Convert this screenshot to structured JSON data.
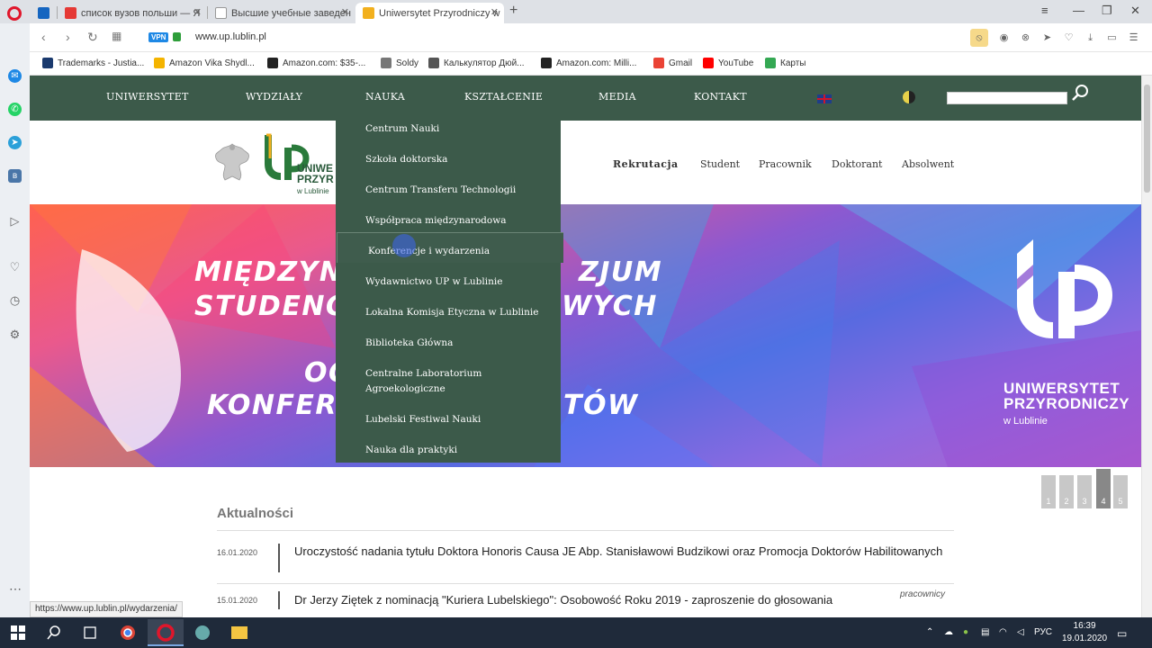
{
  "browser": {
    "tabs": [
      {
        "label": "",
        "icon_color": "#1565c0"
      },
      {
        "label": "список вузов польши — Я",
        "icon_color": "#e53935"
      },
      {
        "label": "Высшие учебные заведен",
        "icon_color": "#333333"
      },
      {
        "label": "Uniwersytet Przyrodniczy w",
        "icon_color": "#f2b01e"
      }
    ],
    "url": "www.up.lublin.pl",
    "vpn_label": "VPN",
    "bookmarks": [
      {
        "label": "Trademarks - Justia...",
        "color": "#1a3a6e"
      },
      {
        "label": "Amazon Vika Shydl...",
        "color": "#f4b400"
      },
      {
        "label": "Amazon.com: $35-...",
        "color": "#222222"
      },
      {
        "label": "Soldy",
        "color": "#777777"
      },
      {
        "label": "Калькулятор Дюй...",
        "color": "#555555"
      },
      {
        "label": "Amazon.com: Milli...",
        "color": "#222222"
      },
      {
        "label": "Gmail",
        "color": "#ea4335"
      },
      {
        "label": "YouTube",
        "color": "#ff0000"
      },
      {
        "label": "Карты",
        "color": "#34a853"
      }
    ]
  },
  "site": {
    "nav": [
      "UNIWERSYTET",
      "WYDZIAŁY",
      "NAUKA",
      "KSZTAŁCENIE",
      "MEDIA",
      "KONTAKT"
    ],
    "logo": {
      "line1": "UNIWE",
      "line2": "PRZYR",
      "line3": "w Lublinie"
    },
    "header_links": [
      "Rekrutacja",
      "Student",
      "Pracownik",
      "Doktorant",
      "Absolwent"
    ],
    "banner": {
      "line1": "MIĘDZYNA",
      "line1b": "ZJUM",
      "line2": "STUDENCK",
      "line2b": "WYCH",
      "line3": "OG",
      "line4": "KONFERE",
      "line4b": "TÓW",
      "brand1": "UNIWERSYTET",
      "brand2": "PRZYRODNICZY",
      "brand3": "w Lublinie"
    },
    "dropdown": [
      "Centrum Nauki",
      "Szkoła doktorska",
      "Centrum Transferu Technologii",
      "Współpraca międzynarodowa",
      "Konferencje i wydarzenia",
      "Wydawnictwo UP w Lublinie",
      "Lokalna Komisja Etyczna w Lublinie",
      "Biblioteka Główna",
      "Centralne Laboratorium Agroekologiczne",
      "Lubelski Festiwal Nauki",
      "Nauka dla praktyki"
    ],
    "pager": [
      "1",
      "2",
      "3",
      "4",
      "5"
    ],
    "news_title": "Aktualności",
    "news": [
      {
        "date": "16.01.2020",
        "text": "Uroczystość nadania tytułu Doktora Honoris Causa JE Abp. Stanisławowi Budzikowi oraz Promocja Doktorów Habilitowanych",
        "tag": ""
      },
      {
        "date": "15.01.2020",
        "text": "Dr Jerzy Ziętek z nominacją \"Kuriera Lubelskiego\": Osobowość Roku 2019 - zaproszenie do głosowania",
        "tag": "pracownicy"
      }
    ],
    "status_url": "https://www.up.lublin.pl/wydarzenia/"
  },
  "taskbar": {
    "lang": "РУС",
    "time": "16:39",
    "date": "19.01.2020"
  },
  "colors": {
    "nav_bg": "#3c5a4a",
    "brand_green": "#2a7a3b",
    "brand_yellow": "#f2b01e"
  }
}
